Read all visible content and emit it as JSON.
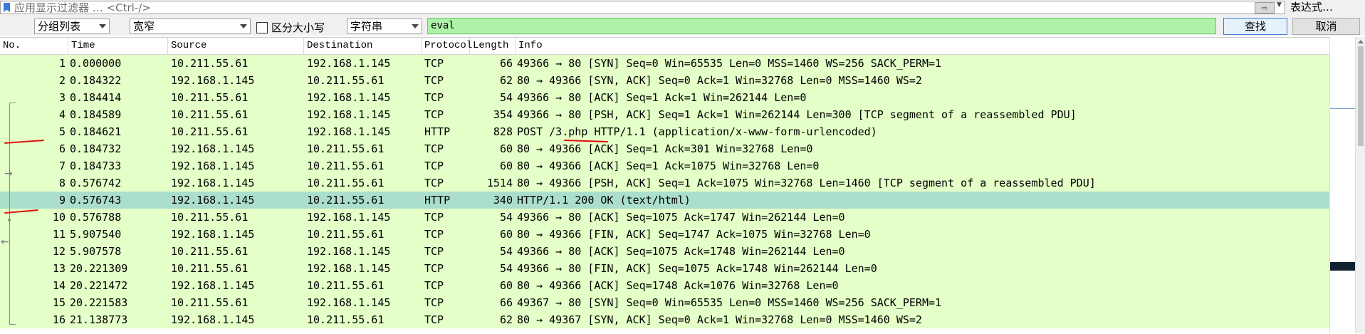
{
  "filter_bar": {
    "placeholder": "应用显示过滤器 … <Ctrl-/>",
    "expression_label": "表达式…"
  },
  "find_bar": {
    "search_in": "分组列表",
    "char_width": "宽窄",
    "case_sensitive_label": "区分大小写",
    "search_type": "字符串",
    "search_value": "eval",
    "find_label": "查找",
    "cancel_label": "取消"
  },
  "packet_list": {
    "columns": [
      "No.",
      "Time",
      "Source",
      "Destination",
      "Protocol",
      "Length",
      "Info"
    ],
    "selected_no": "9",
    "rows": [
      {
        "no": "1",
        "time": "0.000000",
        "src": "10.211.55.61",
        "dst": "192.168.1.145",
        "proto": "TCP",
        "len": "66",
        "info": "49366 → 80 [SYN] Seq=0 Win=65535 Len=0 MSS=1460 WS=256 SACK_PERM=1"
      },
      {
        "no": "2",
        "time": "0.184322",
        "src": "192.168.1.145",
        "dst": "10.211.55.61",
        "proto": "TCP",
        "len": "62",
        "info": "80 → 49366 [SYN, ACK] Seq=0 Ack=1 Win=32768 Len=0 MSS=1460 WS=2"
      },
      {
        "no": "3",
        "time": "0.184414",
        "src": "10.211.55.61",
        "dst": "192.168.1.145",
        "proto": "TCP",
        "len": "54",
        "info": "49366 → 80 [ACK] Seq=1 Ack=1 Win=262144 Len=0"
      },
      {
        "no": "4",
        "time": "0.184589",
        "src": "10.211.55.61",
        "dst": "192.168.1.145",
        "proto": "TCP",
        "len": "354",
        "info": "49366 → 80 [PSH, ACK] Seq=1 Ack=1 Win=262144 Len=300 [TCP segment of a reassembled PDU]"
      },
      {
        "no": "5",
        "time": "0.184621",
        "src": "10.211.55.61",
        "dst": "192.168.1.145",
        "proto": "HTTP",
        "len": "828",
        "info": "POST /3.php HTTP/1.1  (application/x-www-form-urlencoded)"
      },
      {
        "no": "6",
        "time": "0.184732",
        "src": "192.168.1.145",
        "dst": "10.211.55.61",
        "proto": "TCP",
        "len": "60",
        "info": "80 → 49366 [ACK] Seq=1 Ack=301 Win=32768 Len=0"
      },
      {
        "no": "7",
        "time": "0.184733",
        "src": "192.168.1.145",
        "dst": "10.211.55.61",
        "proto": "TCP",
        "len": "60",
        "info": "80 → 49366 [ACK] Seq=1 Ack=1075 Win=32768 Len=0"
      },
      {
        "no": "8",
        "time": "0.576742",
        "src": "192.168.1.145",
        "dst": "10.211.55.61",
        "proto": "TCP",
        "len": "1514",
        "info": "80 → 49366 [PSH, ACK] Seq=1 Ack=1075 Win=32768 Len=1460 [TCP segment of a reassembled PDU]"
      },
      {
        "no": "9",
        "time": "0.576743",
        "src": "192.168.1.145",
        "dst": "10.211.55.61",
        "proto": "HTTP",
        "len": "340",
        "info": "HTTP/1.1 200 OK  (text/html)"
      },
      {
        "no": "10",
        "time": "0.576788",
        "src": "10.211.55.61",
        "dst": "192.168.1.145",
        "proto": "TCP",
        "len": "54",
        "info": "49366 → 80 [ACK] Seq=1075 Ack=1747 Win=262144 Len=0"
      },
      {
        "no": "11",
        "time": "5.907540",
        "src": "192.168.1.145",
        "dst": "10.211.55.61",
        "proto": "TCP",
        "len": "60",
        "info": "80 → 49366 [FIN, ACK] Seq=1747 Ack=1075 Win=32768 Len=0"
      },
      {
        "no": "12",
        "time": "5.907578",
        "src": "10.211.55.61",
        "dst": "192.168.1.145",
        "proto": "TCP",
        "len": "54",
        "info": "49366 → 80 [ACK] Seq=1075 Ack=1748 Win=262144 Len=0"
      },
      {
        "no": "13",
        "time": "20.221309",
        "src": "10.211.55.61",
        "dst": "192.168.1.145",
        "proto": "TCP",
        "len": "54",
        "info": "49366 → 80 [FIN, ACK] Seq=1075 Ack=1748 Win=262144 Len=0"
      },
      {
        "no": "14",
        "time": "20.221472",
        "src": "192.168.1.145",
        "dst": "10.211.55.61",
        "proto": "TCP",
        "len": "60",
        "info": "80 → 49366 [ACK] Seq=1748 Ack=1076 Win=32768 Len=0"
      },
      {
        "no": "15",
        "time": "20.221583",
        "src": "10.211.55.61",
        "dst": "192.168.1.145",
        "proto": "TCP",
        "len": "66",
        "info": "49367 → 80 [SYN] Seq=0 Win=65535 Len=0 MSS=1460 WS=256 SACK_PERM=1"
      },
      {
        "no": "16",
        "time": "21.138773",
        "src": "192.168.1.145",
        "dst": "10.211.55.61",
        "proto": "TCP",
        "len": "62",
        "info": "80 → 49367 [SYN, ACK] Seq=0 Ack=1 Win=32768 Len=0 MSS=1460 WS=2"
      }
    ]
  },
  "colors": {
    "row_bg": "#e4ffc7",
    "selected_row_bg": "#abdfcb",
    "search_field_bg": "#aff3ab",
    "annotation": "#e01010"
  }
}
